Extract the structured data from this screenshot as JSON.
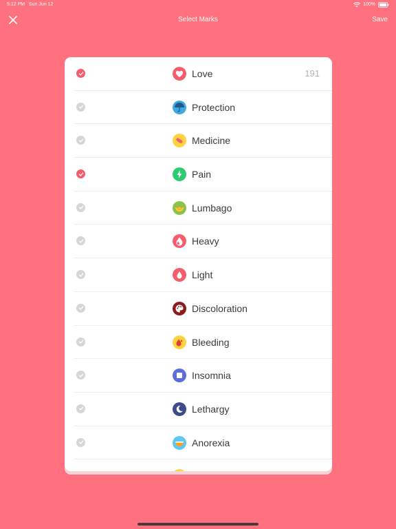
{
  "status": {
    "time": "5:12 PM",
    "date": "Sun Jun 12",
    "battery": "100%"
  },
  "nav": {
    "title": "Select Marks",
    "save_label": "Save"
  },
  "items": [
    {
      "label": "Love",
      "count": "191",
      "checked": true,
      "icon": "heart-icon",
      "color": "#F45E6C"
    },
    {
      "label": "Protection",
      "count": "",
      "checked": false,
      "icon": "umbrella-icon",
      "color": "#3FA9E0"
    },
    {
      "label": "Medicine",
      "count": "",
      "checked": false,
      "icon": "pill-icon",
      "color": "#FFD23F"
    },
    {
      "label": "Pain",
      "count": "",
      "checked": true,
      "icon": "lightning-icon",
      "color": "#2ECC71"
    },
    {
      "label": "Lumbago",
      "count": "",
      "checked": false,
      "icon": "citrus-icon",
      "color": "#8BC34A"
    },
    {
      "label": "Heavy",
      "count": "",
      "checked": false,
      "icon": "drops-icon",
      "color": "#F45E6C"
    },
    {
      "label": "Light",
      "count": "",
      "checked": false,
      "icon": "drop-icon",
      "color": "#F45E6C"
    },
    {
      "label": "Discoloration",
      "count": "",
      "checked": false,
      "icon": "palette-icon",
      "color": "#8E1B1B"
    },
    {
      "label": "Bleeding",
      "count": "",
      "checked": false,
      "icon": "bleeding-drop-icon",
      "color": "#FFD23F"
    },
    {
      "label": "Insomnia",
      "count": "",
      "checked": false,
      "icon": "square-icon",
      "color": "#5C6BE0"
    },
    {
      "label": "Lethargy",
      "count": "",
      "checked": false,
      "icon": "moon-icon",
      "color": "#3F4A8A"
    },
    {
      "label": "Anorexia",
      "count": "",
      "checked": false,
      "icon": "bowl-icon",
      "color": "#5BC8F5"
    },
    {
      "label": "",
      "count": "",
      "checked": false,
      "icon": "partial-icon",
      "color": "#FFD23F"
    }
  ]
}
